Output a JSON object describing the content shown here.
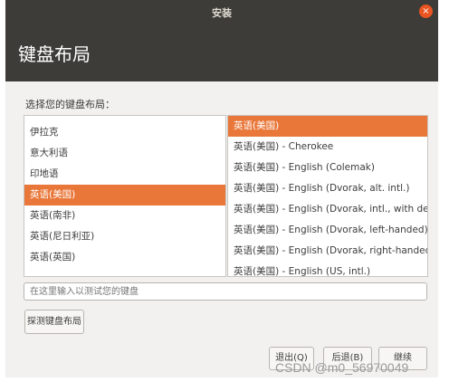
{
  "window": {
    "title": "安装",
    "close_symbol": "×"
  },
  "header": {
    "title": "键盘布局"
  },
  "prompt": "选择您的键盘布局：",
  "languages": [
    {
      "label": "伊拉克",
      "selected": false
    },
    {
      "label": "意大利语",
      "selected": false
    },
    {
      "label": "印地语",
      "selected": false
    },
    {
      "label": "英语(美国)",
      "selected": true
    },
    {
      "label": "英语(南非)",
      "selected": false
    },
    {
      "label": "英语(尼日利亚)",
      "selected": false
    },
    {
      "label": "英语(英国)",
      "selected": false
    }
  ],
  "variants": [
    {
      "label": "英语(美国)",
      "selected": true
    },
    {
      "label": "英语(美国) - Cherokee",
      "selected": false
    },
    {
      "label": "英语(美国) - English (Colemak)",
      "selected": false
    },
    {
      "label": "英语(美国) - English (Dvorak, alt. intl.)",
      "selected": false
    },
    {
      "label": "英语(美国) - English (Dvorak, intl., with dead keys)",
      "selected": false
    },
    {
      "label": "英语(美国) - English (Dvorak, left-handed)",
      "selected": false
    },
    {
      "label": "英语(美国) - English (Dvorak, right-handed)",
      "selected": false
    },
    {
      "label": "英语(美国) - English (US, intl.)",
      "selected": false
    }
  ],
  "test_input": {
    "placeholder": "在这里输入以测试您的键盘",
    "value": ""
  },
  "buttons": {
    "detect": "探测键盘布局",
    "quit": "退出(Q)",
    "back": "后退(B)",
    "continue": "继续"
  },
  "watermark": "CSDN @m0_56970049",
  "colors": {
    "accent": "#e9773a",
    "titlebar": "#3d3c38",
    "close": "#e95420"
  }
}
